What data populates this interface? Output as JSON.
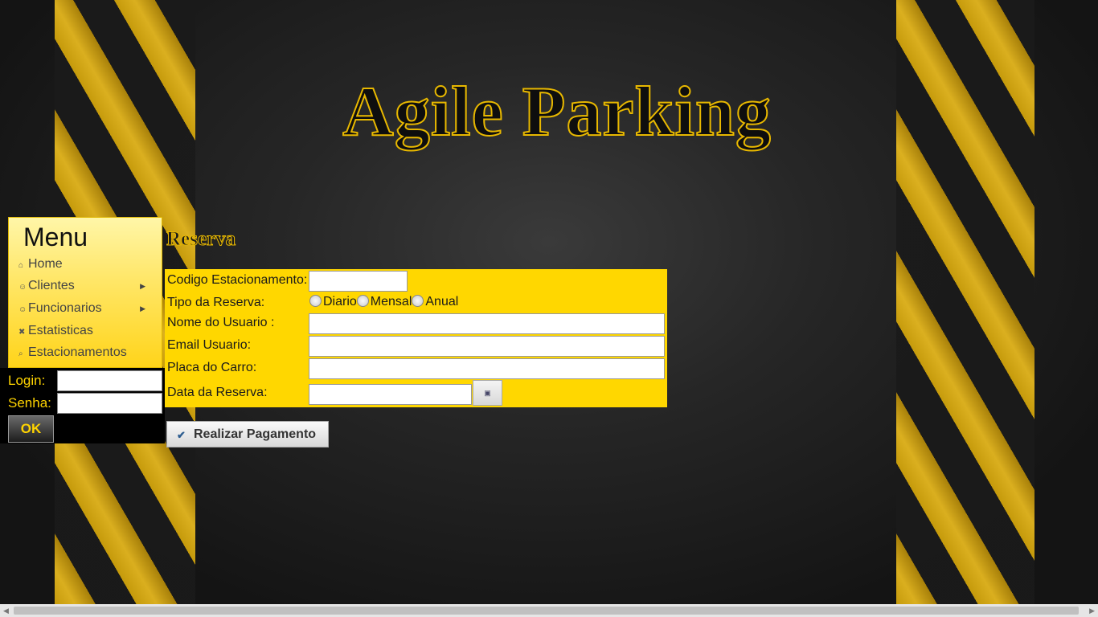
{
  "header": {
    "title": "Agile Parking"
  },
  "menu": {
    "title": "Menu",
    "items": [
      {
        "label": "Home",
        "icon": "home-icon",
        "has_submenu": false
      },
      {
        "label": "Clientes",
        "icon": "person-icon",
        "has_submenu": true
      },
      {
        "label": "Funcionarios",
        "icon": "person-icon",
        "has_submenu": true
      },
      {
        "label": "Estatisticas",
        "icon": "close-icon",
        "has_submenu": false
      },
      {
        "label": "Estacionamentos",
        "icon": "search-icon",
        "has_submenu": false
      }
    ]
  },
  "login": {
    "login_label": "Login:",
    "login_value": "",
    "password_label": "Senha:",
    "password_value": "",
    "submit_label": "OK"
  },
  "reserva": {
    "title": "Reserva",
    "codigo_label": "Codigo Estacionamento:",
    "codigo_value": "",
    "tipo_label": "Tipo da Reserva:",
    "tipo_options": [
      "Diario",
      "Mensal",
      "Anual"
    ],
    "nome_label": "Nome do Usuario :",
    "nome_value": "",
    "email_label": "Email Usuario:",
    "email_value": "",
    "placa_label": "Placa do Carro:",
    "placa_value": "",
    "data_label": "Data da Reserva:",
    "data_value": "",
    "submit_label": "Realizar Pagamento"
  },
  "colors": {
    "accent_yellow": "#ffd700",
    "text_yellow": "#ffd400",
    "background": "#1a1a1a"
  }
}
